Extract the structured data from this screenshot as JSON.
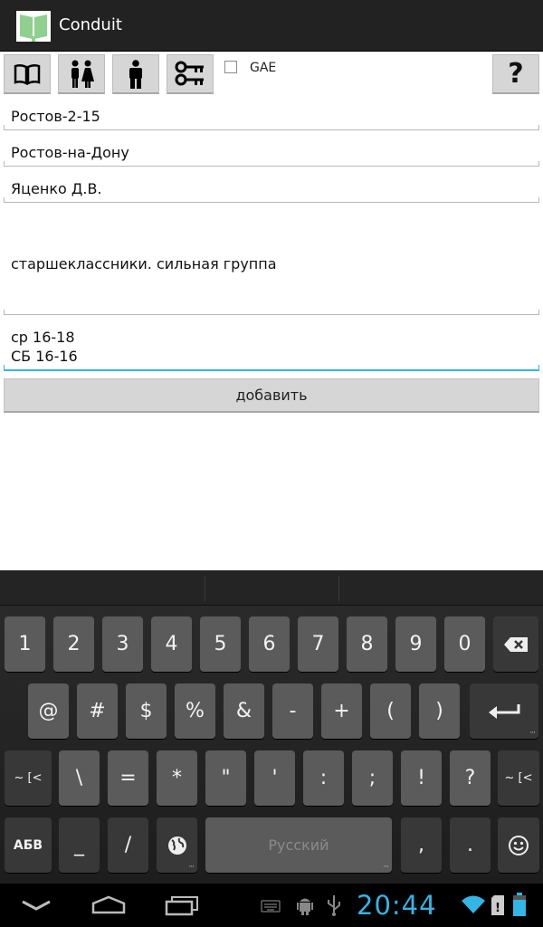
{
  "app": {
    "title": "Conduit"
  },
  "toolbar": {
    "gae_label": "GAE",
    "help_label": "?"
  },
  "form": {
    "name_value": "Ростов-2-15",
    "city_value": "Ростов-на-Дону",
    "teacher_value": "Яценко Д.В.",
    "description_value": "старшеклассники. сильная группа",
    "schedule_value": "ср 16-18\nСБ 16-16",
    "add_label": "добавить"
  },
  "keyboard": {
    "row1": [
      "1",
      "2",
      "3",
      "4",
      "5",
      "6",
      "7",
      "8",
      "9",
      "0"
    ],
    "row2": [
      "@",
      "#",
      "$",
      "%",
      "&",
      "-",
      "+",
      "(",
      ")"
    ],
    "row3": [
      "\\",
      "=",
      "*",
      "\"",
      "'",
      ":",
      ";",
      "!",
      "?"
    ],
    "more_label": "~ [<",
    "abc_label": "АБВ",
    "underscore": "_",
    "slash": "/",
    "space_label": "Русский",
    "comma": ",",
    "period": "."
  },
  "status": {
    "time": "20:44"
  },
  "colors": {
    "accent": "#33b5e5",
    "battery": "#33b5e5"
  }
}
